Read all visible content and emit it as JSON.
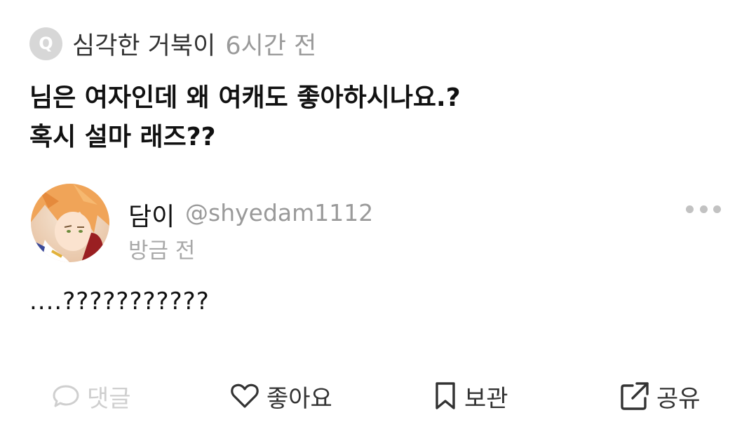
{
  "question": {
    "badge": "Q",
    "asker": "심각한 거북이",
    "time": "6시간 전",
    "line1": "님은 여자인데 왜 여캐도 좋아하시나요.?",
    "line2": "혹시 설마 래즈??"
  },
  "answer": {
    "name": "담이",
    "handle": "@shyedam1112",
    "time": "방금 전",
    "text": "....???????????"
  },
  "actions": {
    "comment": "댓글",
    "like": "좋아요",
    "save": "보관",
    "share": "공유"
  },
  "icons": {
    "comment": "comment-icon",
    "like": "heart-icon",
    "save": "bookmark-icon",
    "share": "share-icon",
    "more": "more-icon"
  },
  "colors": {
    "muted": "#9a9a9a",
    "disabled": "#cfcfcf",
    "text": "#111111"
  }
}
